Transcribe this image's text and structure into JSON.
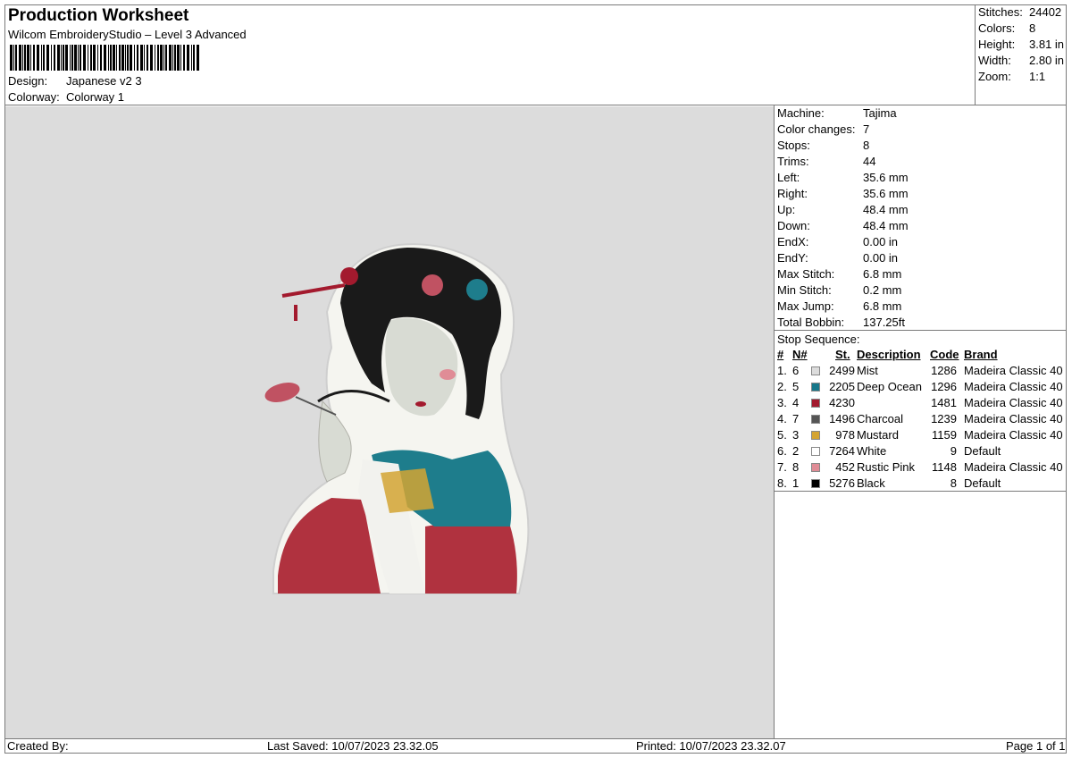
{
  "header": {
    "title": "Production Worksheet",
    "subtitle": "Wilcom EmbroideryStudio – Level 3 Advanced",
    "design_label": "Design:",
    "design_value": "Japanese v2 3",
    "colorway_label": "Colorway:",
    "colorway_value": "Colorway 1"
  },
  "summary": [
    {
      "label": "Stitches:",
      "value": "24402"
    },
    {
      "label": "Colors:",
      "value": "8"
    },
    {
      "label": "Height:",
      "value": "3.81 in"
    },
    {
      "label": "Width:",
      "value": "2.80 in"
    },
    {
      "label": "Zoom:",
      "value": "1:1"
    }
  ],
  "machine_info": [
    {
      "label": "Machine:",
      "value": "Tajima"
    },
    {
      "label": "Color changes:",
      "value": "7"
    },
    {
      "label": "Stops:",
      "value": "8"
    },
    {
      "label": "Trims:",
      "value": "44"
    },
    {
      "label": "Left:",
      "value": "35.6 mm"
    },
    {
      "label": "Right:",
      "value": "35.6 mm"
    },
    {
      "label": "Up:",
      "value": "48.4 mm"
    },
    {
      "label": "Down:",
      "value": "48.4 mm"
    },
    {
      "label": "EndX:",
      "value": "0.00 in"
    },
    {
      "label": "EndY:",
      "value": "0.00 in"
    },
    {
      "label": "Max Stitch:",
      "value": "6.8 mm"
    },
    {
      "label": "Min Stitch:",
      "value": "0.2 mm"
    },
    {
      "label": "Max Jump:",
      "value": "6.8 mm"
    },
    {
      "label": "Total Bobbin:",
      "value": "137.25ft"
    }
  ],
  "stop_sequence": {
    "title": "Stop Sequence:",
    "headers": {
      "num": "#",
      "n": "N#",
      "st": "St.",
      "description": "Description",
      "code": "Code",
      "brand": "Brand"
    },
    "rows": [
      {
        "num": "1.",
        "n": "6",
        "color": "#dcdcdc",
        "st": "2499",
        "description": "Mist",
        "code": "1286",
        "brand": "Madeira Classic 40"
      },
      {
        "num": "2.",
        "n": "5",
        "color": "#17778a",
        "st": "2205",
        "description": "Deep Ocean",
        "code": "1296",
        "brand": "Madeira Classic 40"
      },
      {
        "num": "3.",
        "n": "4",
        "color": "#a31a2e",
        "st": "4230",
        "description": "",
        "code": "1481",
        "brand": "Madeira Classic 40"
      },
      {
        "num": "4.",
        "n": "7",
        "color": "#555555",
        "st": "1496",
        "description": "Charcoal",
        "code": "1239",
        "brand": "Madeira Classic 40"
      },
      {
        "num": "5.",
        "n": "3",
        "color": "#d4a433",
        "st": "978",
        "description": "Mustard",
        "code": "1159",
        "brand": "Madeira Classic 40"
      },
      {
        "num": "6.",
        "n": "2",
        "color": "#ffffff",
        "st": "7264",
        "description": "White",
        "code": "9",
        "brand": "Default"
      },
      {
        "num": "7.",
        "n": "8",
        "color": "#e08c96",
        "st": "452",
        "description": "Rustic Pink",
        "code": "1148",
        "brand": "Madeira Classic 40"
      },
      {
        "num": "8.",
        "n": "1",
        "color": "#000000",
        "st": "5276",
        "description": "Black",
        "code": "8",
        "brand": "Default"
      }
    ]
  },
  "footer": {
    "created_by": "Created By:",
    "last_saved": "Last Saved: 10/07/2023 23.32.05",
    "printed": "Printed: 10/07/2023 23.32.07",
    "page": "Page 1 of 1"
  },
  "colors": {
    "canvas_bg": "#dcdcdc",
    "border": "#7a7a7a"
  }
}
